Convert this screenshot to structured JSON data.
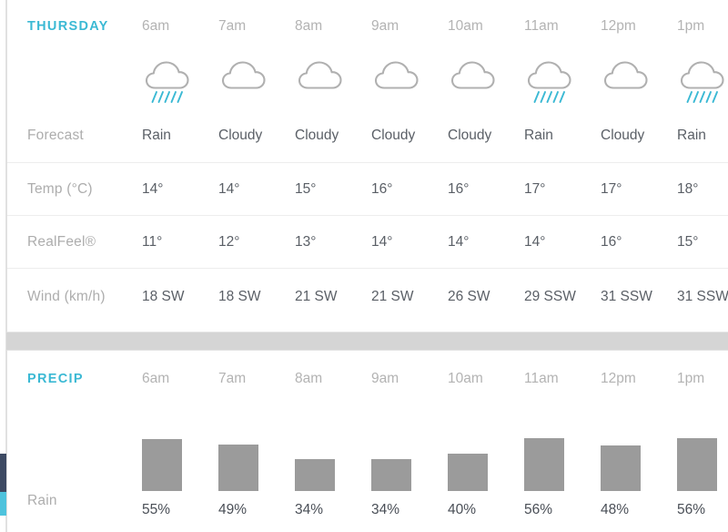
{
  "theme": {
    "accent": "#3bb9d4",
    "label_gray": "#adadad",
    "value_gray": "#5a5f66",
    "hour_gray": "#b3b3b3",
    "bar_gray": "#9b9b9b",
    "panel_bg": "#ffffff",
    "page_bg": "#d5d5d5",
    "divider": "#ededed",
    "scrollbar_thumb": "#3d4a63",
    "scrollbar_accent": "#4ec3dd"
  },
  "hourly": {
    "day_label": "THURSDAY",
    "hours": [
      "6am",
      "7am",
      "8am",
      "9am",
      "10am",
      "11am",
      "12pm",
      "1pm"
    ],
    "icons": [
      "rain-icon",
      "cloudy-icon",
      "cloudy-icon",
      "cloudy-icon",
      "cloudy-icon",
      "rain-icon",
      "cloudy-icon",
      "rain-icon"
    ],
    "rows": [
      {
        "label": "Forecast",
        "values": [
          "Rain",
          "Cloudy",
          "Cloudy",
          "Cloudy",
          "Cloudy",
          "Rain",
          "Cloudy",
          "Rain"
        ]
      },
      {
        "label": "Temp (°C)",
        "values": [
          "14°",
          "14°",
          "15°",
          "16°",
          "16°",
          "17°",
          "17°",
          "18°"
        ]
      },
      {
        "label": "RealFeel®",
        "values": [
          "11°",
          "12°",
          "13°",
          "14°",
          "14°",
          "14°",
          "16°",
          "15°"
        ]
      },
      {
        "label": "Wind (km/h)",
        "values": [
          "18 SW",
          "18 SW",
          "21 SW",
          "21 SW",
          "26 SW",
          "29 SSW",
          "31 SSW",
          "31 SSW"
        ]
      }
    ]
  },
  "precip": {
    "section_label": "PRECIP",
    "hours": [
      "6am",
      "7am",
      "8am",
      "9am",
      "10am",
      "11am",
      "12pm",
      "1pm"
    ],
    "row_label": "Rain",
    "labels": [
      "55%",
      "49%",
      "34%",
      "34%",
      "40%",
      "56%",
      "48%",
      "56%"
    ]
  },
  "chart_data": {
    "type": "bar",
    "title": "PRECIP",
    "xlabel": "",
    "ylabel": "Rain",
    "categories": [
      "6am",
      "7am",
      "8am",
      "9am",
      "10am",
      "11am",
      "12pm",
      "1pm"
    ],
    "values": [
      55,
      49,
      34,
      34,
      40,
      56,
      48,
      56
    ],
    "value_labels": [
      "55%",
      "49%",
      "34%",
      "34%",
      "40%",
      "56%",
      "48%",
      "56%"
    ],
    "ylim": [
      0,
      60
    ],
    "grid": false,
    "legend": false,
    "bar_color": "#9b9b9b"
  }
}
